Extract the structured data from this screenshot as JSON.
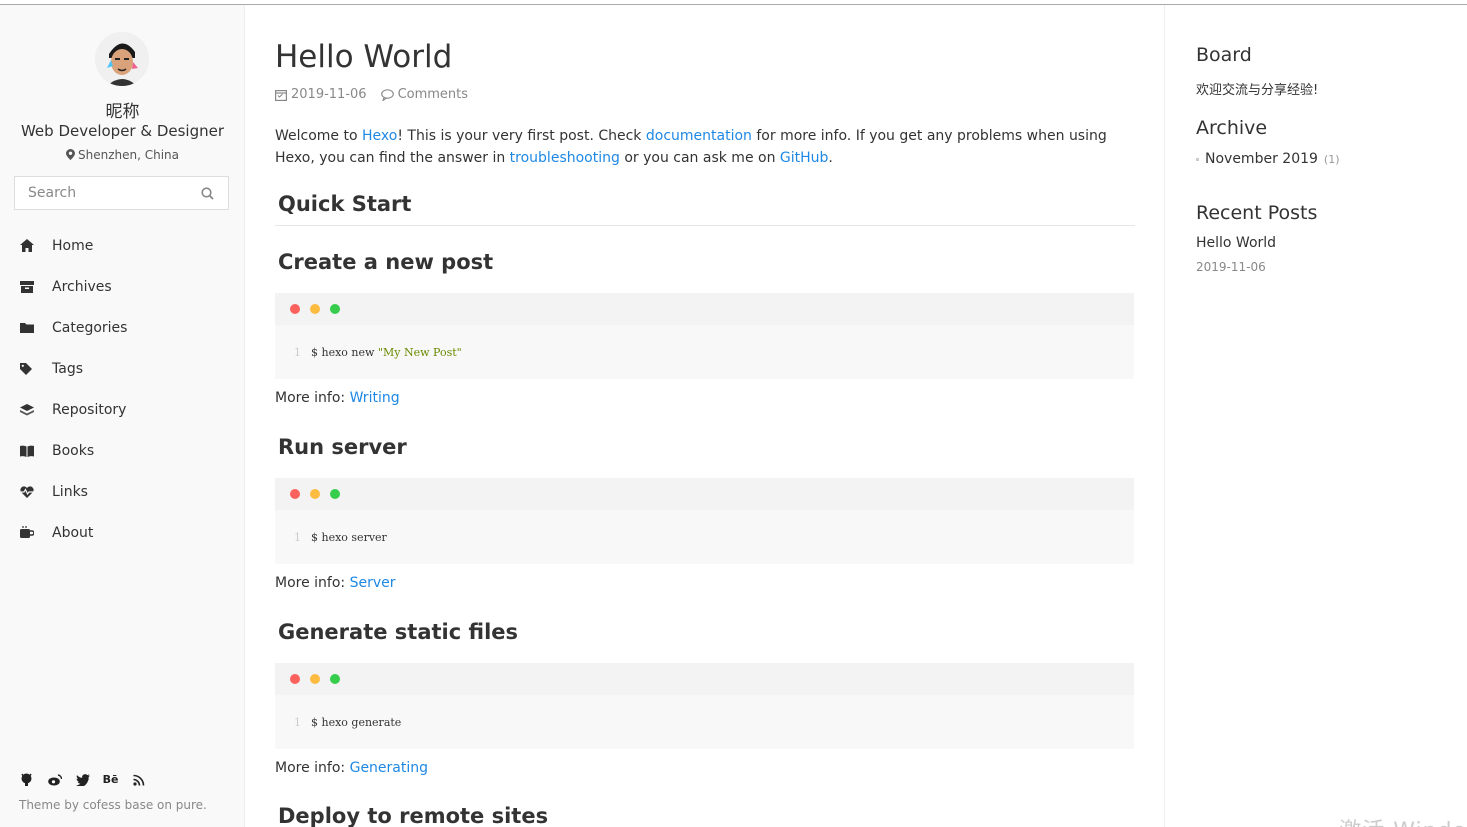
{
  "sidebar": {
    "nickname": "昵称",
    "role": "Web Developer & Designer",
    "location": "Shenzhen, China",
    "search_placeholder": "Search",
    "nav": [
      {
        "label": "Home",
        "icon": "home-icon"
      },
      {
        "label": "Archives",
        "icon": "archive-icon"
      },
      {
        "label": "Categories",
        "icon": "folder-icon"
      },
      {
        "label": "Tags",
        "icon": "tags-icon"
      },
      {
        "label": "Repository",
        "icon": "layers-icon"
      },
      {
        "label": "Books",
        "icon": "book-icon"
      },
      {
        "label": "Links",
        "icon": "heartbeat-icon"
      },
      {
        "label": "About",
        "icon": "coffee-icon"
      }
    ],
    "social": [
      "github-icon",
      "weibo-icon",
      "twitter-icon",
      "behance-icon",
      "rss-icon"
    ],
    "behance_label": "Bē",
    "theme_credit": "Theme by cofess base on pure."
  },
  "post": {
    "title": "Hello World",
    "date": "2019-11-06",
    "comments": "Comments",
    "intro": {
      "p1": "Welcome to ",
      "link_hexo": "Hexo",
      "p2": "! This is your very first post. Check ",
      "link_docs": "documentation",
      "p3": " for more info. If you get any problems when using Hexo, you can find the answer in ",
      "link_trouble": "troubleshooting",
      "p4": " or you can ask me on ",
      "link_github": "GitHub",
      "p5": "."
    },
    "quick_start": "Quick Start",
    "sections": [
      {
        "heading": "Create a new post",
        "line_no": "1",
        "cmd": "$ hexo new ",
        "str": "\"My New Post\"",
        "more_label": "More info: ",
        "more_link": "Writing"
      },
      {
        "heading": "Run server",
        "line_no": "1",
        "cmd": "$ hexo server",
        "str": "",
        "more_label": "More info: ",
        "more_link": "Server"
      },
      {
        "heading": "Generate static files",
        "line_no": "1",
        "cmd": "$ hexo generate",
        "str": "",
        "more_label": "More info: ",
        "more_link": "Generating"
      }
    ],
    "last_heading": "Deploy to remote sites"
  },
  "right": {
    "board_title": "Board",
    "board_text": "欢迎交流与分享经验!",
    "archive_title": "Archive",
    "archive_item": "November 2019",
    "archive_count": "(1)",
    "recent_title": "Recent Posts",
    "recent_post": "Hello World",
    "recent_date": "2019-11-06"
  },
  "watermark": "激活 Windo",
  "colors": {
    "link": "#1e88e5",
    "dot_red": "#fc625d",
    "dot_yellow": "#fdbc40",
    "dot_green": "#35cd4b"
  }
}
